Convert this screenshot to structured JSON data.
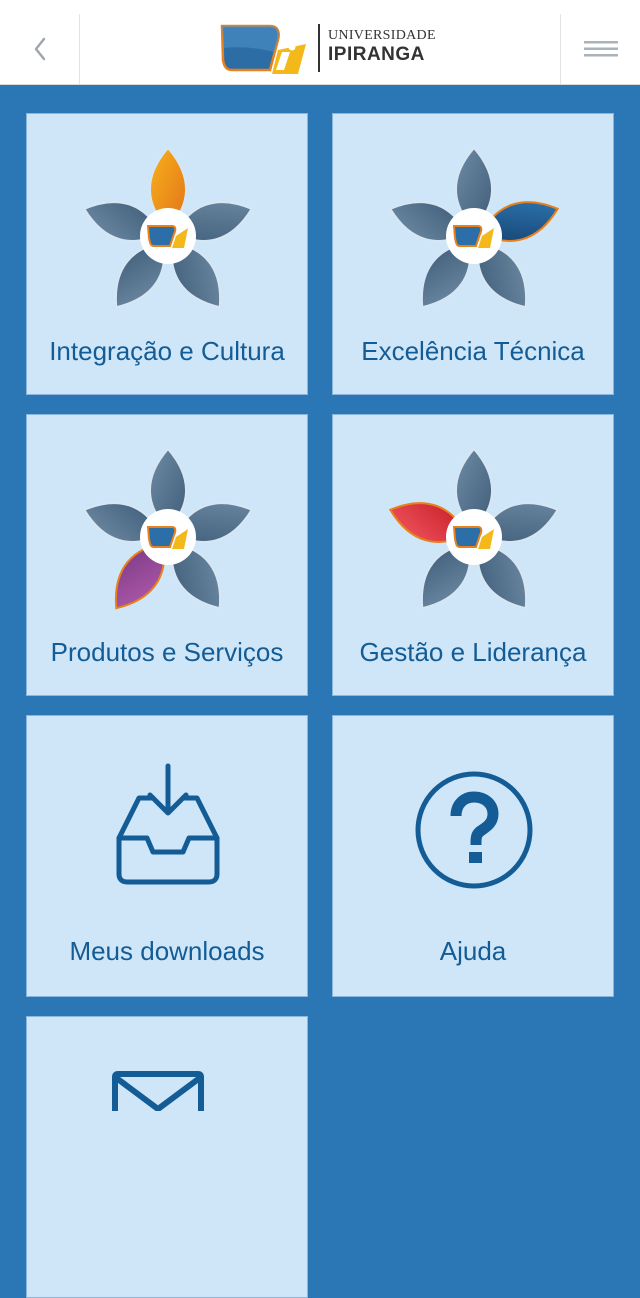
{
  "header": {
    "back_icon": "chevron-left-icon",
    "menu_icon": "hamburger-menu-icon",
    "logo": {
      "line1": "UNIVERSIDADE",
      "line2": "IPIRANGA"
    }
  },
  "colors": {
    "background": "#2b77b6",
    "tile": "#cfe6f8",
    "label": "#135c96",
    "petal": "#54728e",
    "highlight_integracao": "#f0940f",
    "highlight_excelencia": "#1c5f94",
    "highlight_produtos": "#9b4c9c",
    "highlight_gestao": "#e5333c"
  },
  "tiles": [
    {
      "label": "Integração e Cultura",
      "icon": "flower-orange-petal-icon"
    },
    {
      "label": "Excelência Técnica",
      "icon": "flower-blue-petal-icon"
    },
    {
      "label": "Produtos e Serviços",
      "icon": "flower-purple-petal-icon"
    },
    {
      "label": "Gestão e Liderança",
      "icon": "flower-red-petal-icon"
    },
    {
      "label": "Meus downloads",
      "icon": "download-inbox-icon"
    },
    {
      "label": "Ajuda",
      "icon": "help-question-icon"
    },
    {
      "label": "",
      "icon": "mail-envelope-icon"
    }
  ]
}
